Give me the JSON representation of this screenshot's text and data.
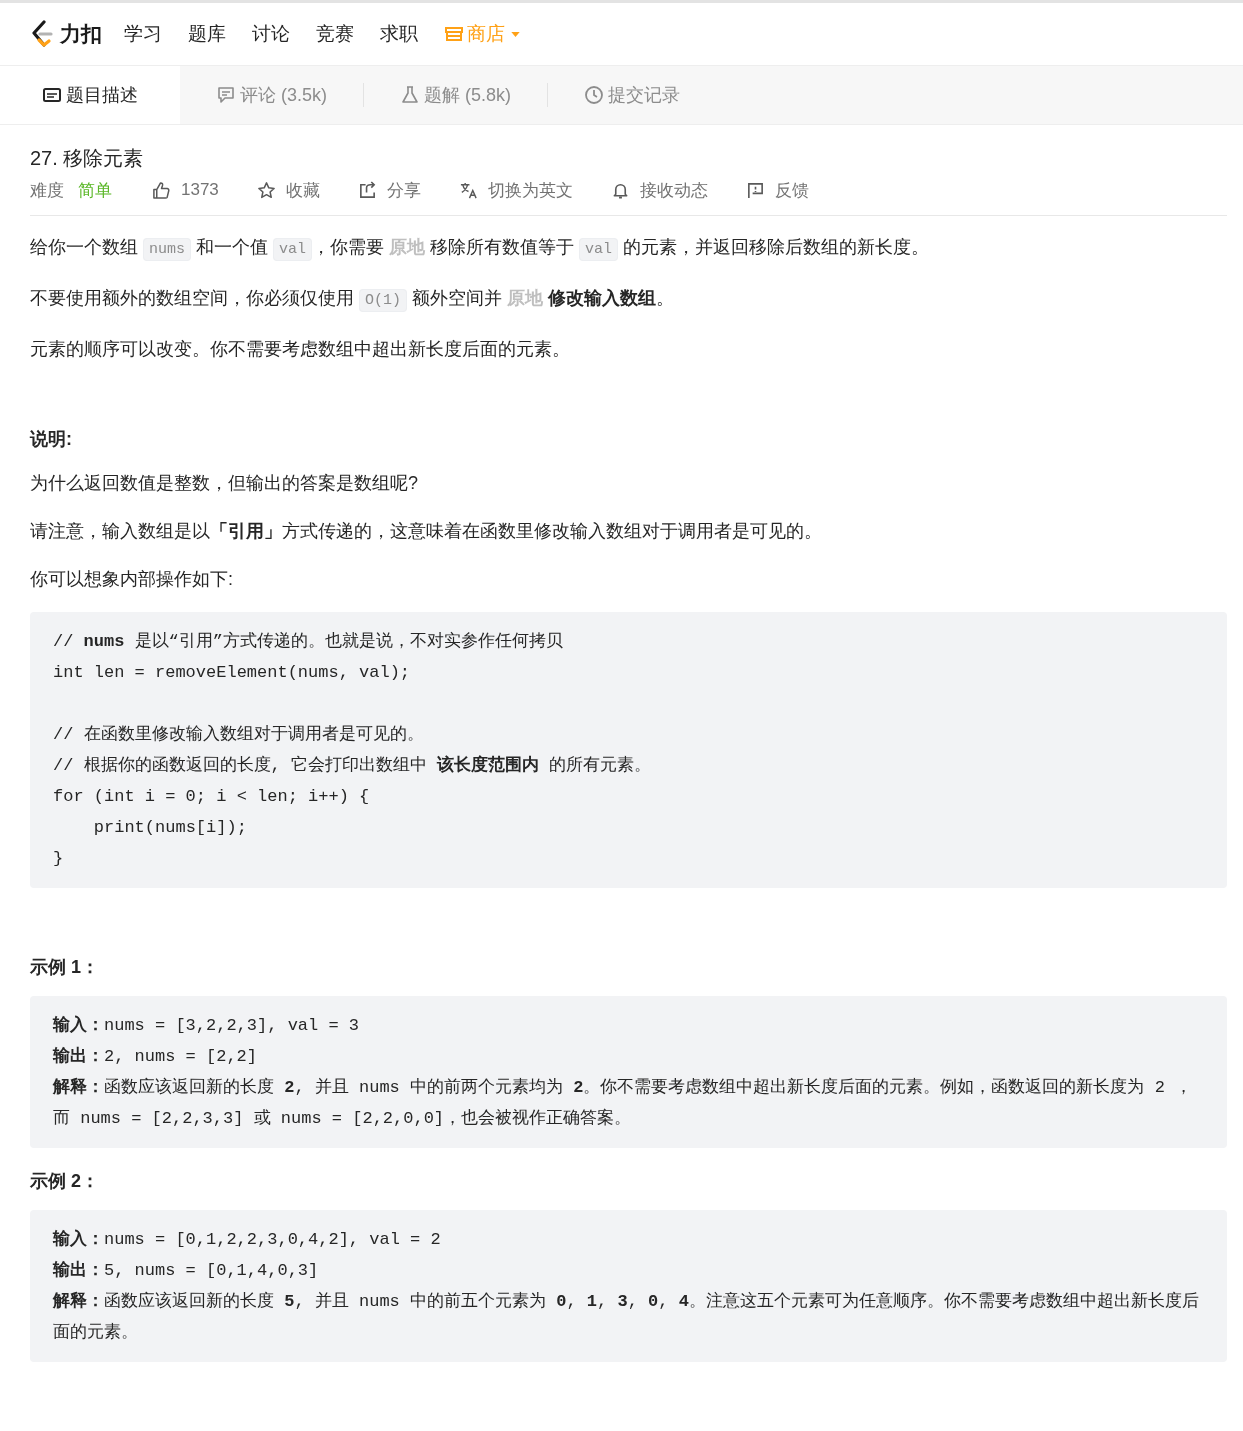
{
  "nav": {
    "logo_text": "力扣",
    "items": [
      {
        "label": "学习",
        "kind": "plain"
      },
      {
        "label": "题库",
        "kind": "plain"
      },
      {
        "label": "讨论",
        "kind": "plain"
      },
      {
        "label": "竞赛",
        "kind": "plain"
      },
      {
        "label": "求职",
        "kind": "plain"
      },
      {
        "label": "商店",
        "kind": "store"
      }
    ]
  },
  "tabs": [
    {
      "label": "题目描述",
      "selected": true
    },
    {
      "label": "评论 (3.5k)",
      "selected": false
    },
    {
      "label": "题解 (5.8k)",
      "selected": false
    },
    {
      "label": "提交记录",
      "selected": false
    }
  ],
  "problem": {
    "title": "27. 移除元素",
    "difficulty_label": "难度",
    "difficulty": {
      "text": "简单",
      "kind": "easy"
    },
    "actions": [
      {
        "label": "1373"
      },
      {
        "label": "收藏"
      },
      {
        "label": "分享"
      },
      {
        "label": "切换为英文"
      },
      {
        "label": "接收动态"
      },
      {
        "label": "反馈"
      }
    ]
  },
  "content": [
    {
      "kind": "paragraph",
      "parts": [
        {
          "kind": "text",
          "text": "给你一个数组 "
        },
        {
          "kind": "code",
          "text": "nums"
        },
        {
          "kind": "text",
          "text": " 和一个值 "
        },
        {
          "kind": "code",
          "text": "val"
        },
        {
          "kind": "text",
          "text": "，你需要 "
        },
        {
          "kind": "link",
          "text": "原地"
        },
        {
          "kind": "text",
          "text": " 移除所有数值等于 "
        },
        {
          "kind": "code",
          "text": "val"
        },
        {
          "kind": "text",
          "text": " 的元素，并返回移除后数组的新长度。"
        }
      ]
    },
    {
      "kind": "paragraph",
      "parts": [
        {
          "kind": "text",
          "text": "不要使用额外的数组空间，你必须仅使用 "
        },
        {
          "kind": "code",
          "text": "O(1)"
        },
        {
          "kind": "text",
          "text": " 额外空间并 "
        },
        {
          "kind": "link",
          "text": "原地"
        },
        {
          "kind": "text",
          "text": " **修改输入数组**。"
        }
      ]
    },
    {
      "kind": "paragraph",
      "parts": [
        {
          "kind": "text",
          "text": "元素的顺序可以改变。你不需要考虑数组中超出新长度后面的元素。"
        }
      ]
    },
    {
      "kind": "heading",
      "text": "说明:"
    },
    {
      "kind": "paragraph",
      "parts": [
        {
          "kind": "text",
          "text": "为什么返回数值是整数，但输出的答案是数组呢?"
        }
      ]
    },
    {
      "kind": "paragraph",
      "parts": [
        {
          "kind": "text",
          "text": "请注意，输入数组是以**「引用」**方式传递的，这意味着在函数里修改输入数组对于调用者是可见的。"
        }
      ]
    },
    {
      "kind": "paragraph",
      "parts": [
        {
          "kind": "text",
          "text": "你可以想象内部操作如下:"
        }
      ]
    },
    {
      "kind": "code_block",
      "text": "// **nums** 是以“引用”方式传递的。也就是说，不对实参作任何拷贝\nint len = removeElement(nums, val);\n\n// 在函数里修改输入数组对于调用者是可见的。\n// 根据你的函数返回的长度, 它会打印出数组中 **该长度范围内** 的所有元素。\nfor (int i = 0; i < len; i++) {\n    print(nums[i]);\n}"
    },
    {
      "kind": "heading",
      "text": "示例 1："
    },
    {
      "kind": "code_block",
      "text": "**输入：**nums = [3,2,2,3], val = 3\n**输出：**2, nums = [2,2]\n**解释：**函数应该返回新的长度 **2**, 并且 nums 中的前两个元素均为 **2**。你不需要考虑数组中超出新长度后面的元素。例如，函数返回的新长度为 2 ，而 nums = [2,2,3,3] 或 nums = [2,2,0,0]，也会被视作正确答案。"
    },
    {
      "kind": "heading",
      "text": "示例 2："
    },
    {
      "kind": "code_block",
      "text": "**输入：**nums = [0,1,2,2,3,0,4,2], val = 2\n**输出：**5, nums = [0,1,4,0,3]\n**解释：**函数应该返回新的长度 **5**, 并且 nums 中的前五个元素为 **0**, **1**, **3**, **0**, **4**。注意这五个元素可为任意顺序。你不需要考虑数组中超出新长度后面的元素。"
    }
  ]
}
